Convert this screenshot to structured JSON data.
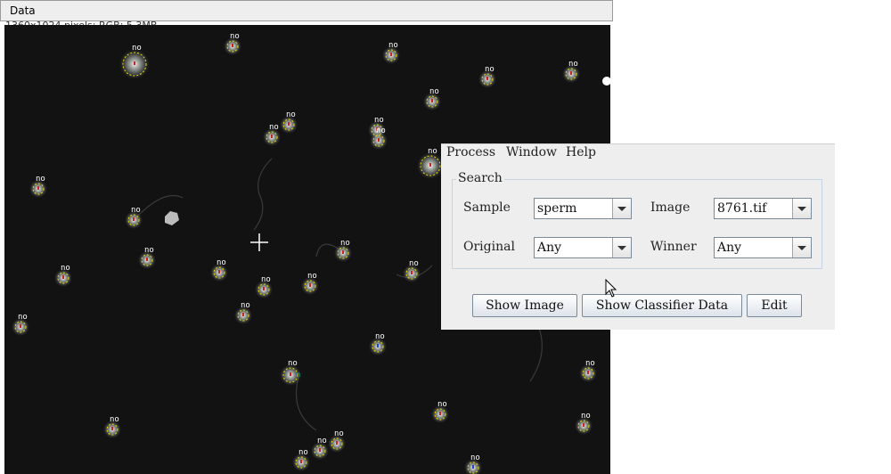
{
  "image_window": {
    "title": "Data",
    "info": "1360x1024 pixels; RGB; 5.3MB",
    "cell_label": "no",
    "selected_label": "n"
  },
  "dialog": {
    "menu": [
      "Process",
      "Window",
      "Help"
    ],
    "search_legend": "Search",
    "sample_label": "Sample",
    "sample_value": "sperm",
    "image_label": "Image",
    "image_value": "8761.tif",
    "original_label": "Original",
    "original_value": "Any",
    "winner_label": "Winner",
    "winner_value": "Any",
    "show_image_button": "Show Image",
    "show_classifier_button": "Show Classifier Data",
    "edit_button": "Edit"
  },
  "colors": {
    "background": "#121212",
    "ring": "#e8e000",
    "head_red": "#cc2222",
    "head_blue": "#2244cc",
    "teal": "#00a090",
    "dialog_bg": "#eeeeee"
  },
  "icons": {
    "crosshair": "crosshair-icon",
    "pointer": "arrow-pointer-icon"
  }
}
